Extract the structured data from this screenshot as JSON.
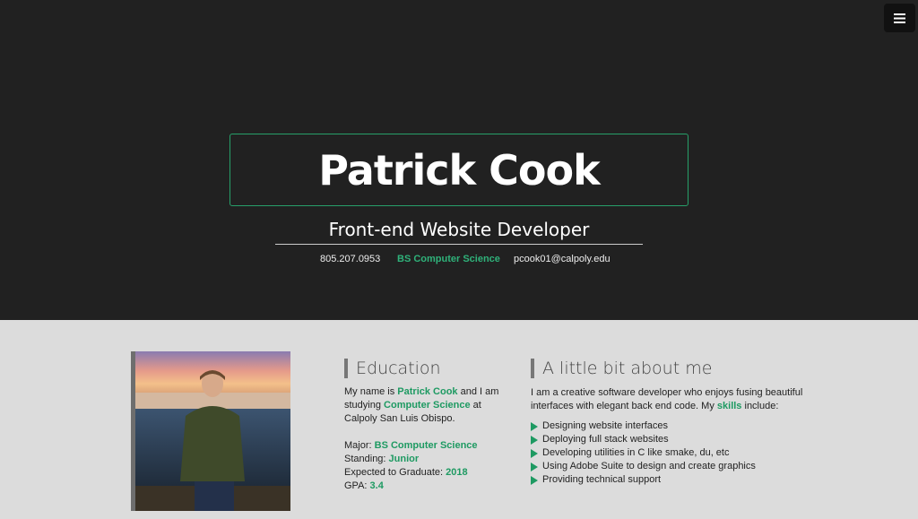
{
  "hero": {
    "name": "Patrick Cook",
    "role": "Front-end Website Developer",
    "phone": "805.207.0953",
    "degree": "BS Computer Science",
    "email": "pcook01@calpoly.edu"
  },
  "menu": {
    "icon": "hamburger-menu-icon"
  },
  "education": {
    "heading": "Education",
    "p1": "My name is ",
    "name": "Patrick Cook",
    "p2": " and I am studying ",
    "field": "Computer Science",
    "p3": " at Calpoly San Luis Obispo.",
    "major_label": "Major: ",
    "major": "BS Computer Science",
    "standing_label": "Standing: ",
    "standing": "Junior",
    "grad_label": "Expected to Graduate: ",
    "grad": "2018",
    "gpa_label": "GPA: ",
    "gpa": "3.4"
  },
  "about": {
    "heading": "A little bit about me",
    "intro1": "I am a creative software developer who enjoys fusing beautiful interfaces with elegant back end code. My ",
    "skills_word": "skills",
    "intro2": " include:",
    "skills": [
      "Designing website interfaces",
      "Deploying full stack websites",
      "Developing utilities in C like smake, du, etc",
      "Using Adobe Suite to design and create graphics",
      "Providing technical support"
    ]
  },
  "colors": {
    "accent": "#1e9a62",
    "hero_bg": "#212121",
    "body_bg": "#dcdcdc"
  }
}
